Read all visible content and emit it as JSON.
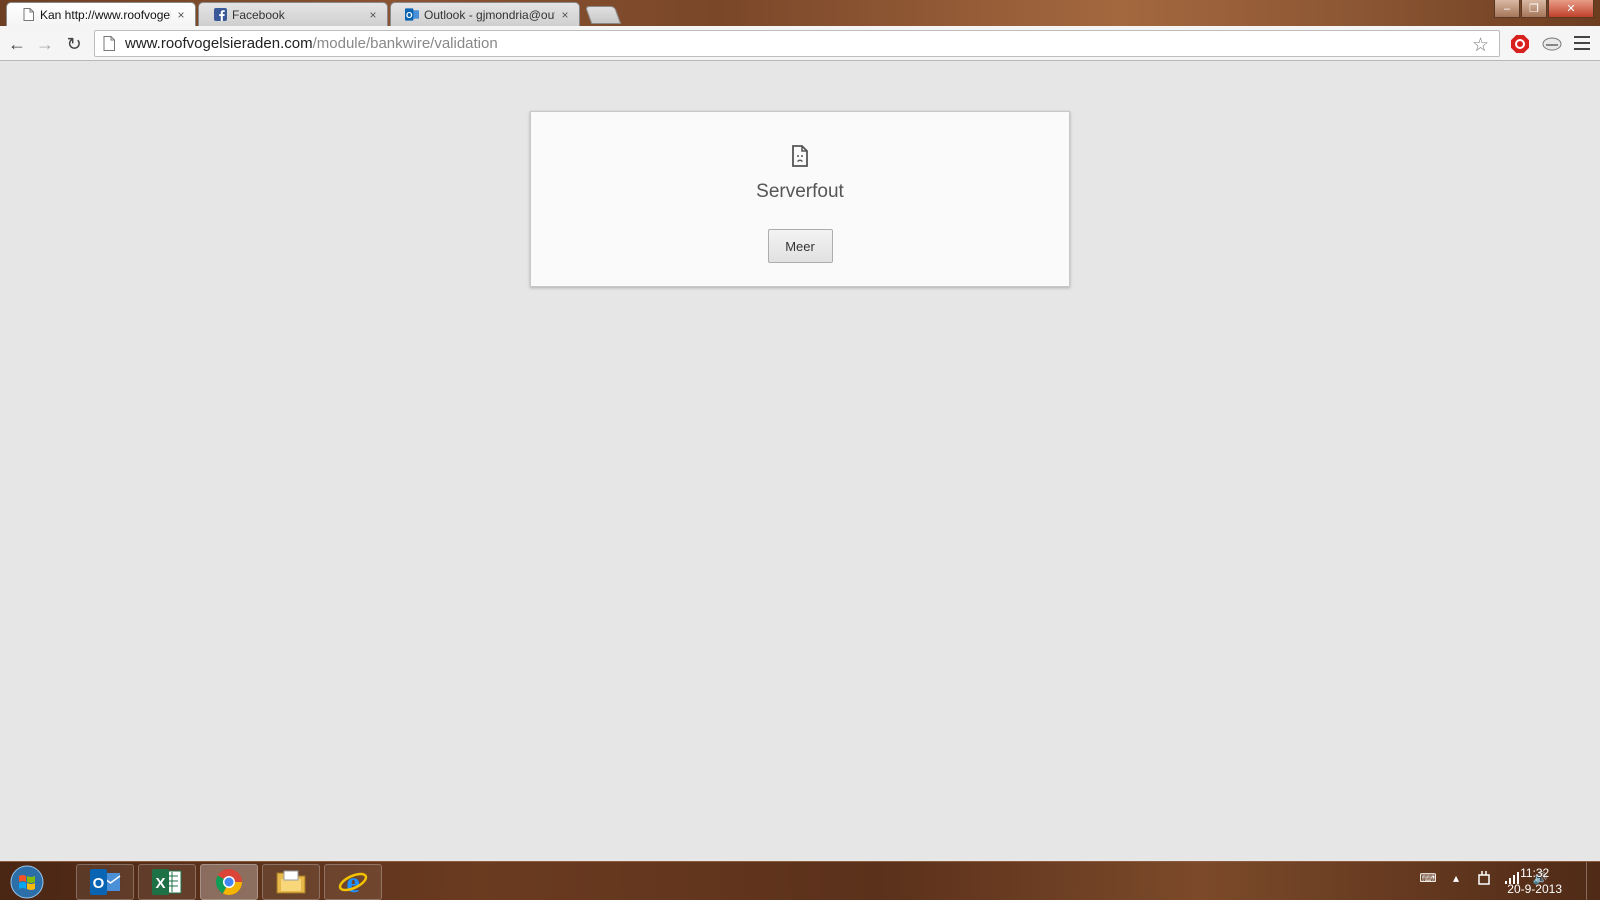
{
  "browser": {
    "tabs": [
      {
        "title": "Kan http://www.roofvogelsieraden.com",
        "favicon": "page-icon",
        "active": true,
        "close": "×"
      },
      {
        "title": "Facebook",
        "favicon": "facebook-icon",
        "active": false,
        "close": "×"
      },
      {
        "title": "Outlook - gjmondria@outlook.com",
        "favicon": "outlook-icon",
        "active": false,
        "close": "×"
      }
    ],
    "window_controls": {
      "minimize": "–",
      "maximize": "❐",
      "close": "✕"
    },
    "toolbar": {
      "back": "←",
      "forward": "→",
      "reload": "↻",
      "url_host": "www.roofvogelsieraden.com",
      "url_path": "/module/bankwire/validation",
      "bookmark_star": "☆"
    }
  },
  "page": {
    "error_title": "Serverfout",
    "more_button": "Meer"
  },
  "taskbar": {
    "apps": [
      "outlook-icon",
      "excel-icon",
      "chrome-icon",
      "file-explorer-icon",
      "internet-explorer-icon"
    ],
    "active_app": "chrome-icon",
    "clock_time": "11:32",
    "clock_date": "20-9-2013"
  },
  "colors": {
    "page_background": "#e6e6e6",
    "card_background": "#fafafa",
    "url_host": "#222222",
    "url_path": "#888888"
  }
}
